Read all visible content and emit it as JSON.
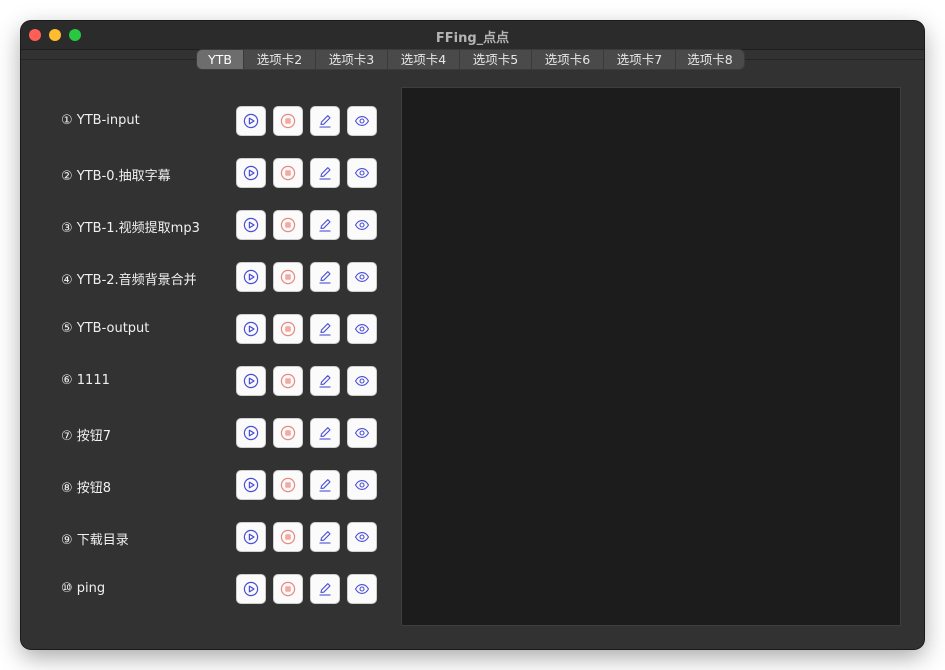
{
  "window": {
    "title": "FFing_点点"
  },
  "tabs": [
    {
      "label": "YTB",
      "active": true
    },
    {
      "label": "选项卡2",
      "active": false
    },
    {
      "label": "选项卡3",
      "active": false
    },
    {
      "label": "选项卡4",
      "active": false
    },
    {
      "label": "选项卡5",
      "active": false
    },
    {
      "label": "选项卡6",
      "active": false
    },
    {
      "label": "选项卡7",
      "active": false
    },
    {
      "label": "选项卡8",
      "active": false
    }
  ],
  "tasks": [
    {
      "label": "① YTB-input"
    },
    {
      "label": "② YTB-0.抽取字幕"
    },
    {
      "label": "③ YTB-1.视频提取mp3"
    },
    {
      "label": "④ YTB-2.音频背景合并"
    },
    {
      "label": "⑤ YTB-output"
    },
    {
      "label": "⑥ 1111"
    },
    {
      "label": "⑦ 按钮7"
    },
    {
      "label": "⑧ 按钮8"
    },
    {
      "label": "⑨ 下载目录"
    },
    {
      "label": "⑩ ping"
    }
  ],
  "row_buttons": [
    {
      "name": "run-button",
      "icon": "play-circle-icon"
    },
    {
      "name": "stop-button",
      "icon": "stop-circle-icon"
    },
    {
      "name": "edit-button",
      "icon": "pencil-icon"
    },
    {
      "name": "view-button",
      "icon": "eye-icon"
    }
  ],
  "colors": {
    "window_bg": "#323232",
    "output_bg": "#1c1c1c",
    "icon_blue": "#4b4fd6",
    "icon_red": "#e58a80",
    "traffic_close": "#fe5f57",
    "traffic_min": "#febc2e",
    "traffic_max": "#28c840"
  }
}
